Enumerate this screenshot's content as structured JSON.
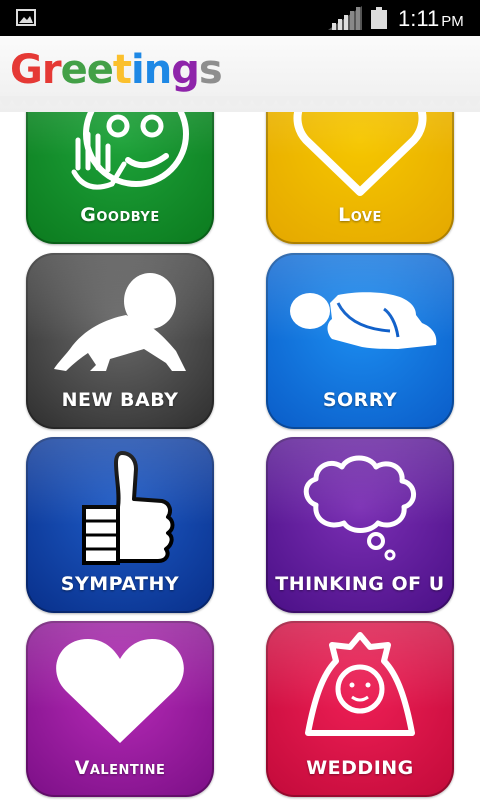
{
  "status_bar": {
    "time": "1:11",
    "ampm": "PM",
    "icons": [
      "image-icon",
      "signal-icon",
      "battery-icon"
    ]
  },
  "header": {
    "title_letters": [
      {
        "ch": "G",
        "color": "#e53935"
      },
      {
        "ch": "r",
        "color": "#e53935"
      },
      {
        "ch": "e",
        "color": "#43a047"
      },
      {
        "ch": "e",
        "color": "#43a047"
      },
      {
        "ch": "t",
        "color": "#fbc02d"
      },
      {
        "ch": "i",
        "color": "#1e88e5"
      },
      {
        "ch": "n",
        "color": "#1e88e5"
      },
      {
        "ch": "g",
        "color": "#8e24aa"
      },
      {
        "ch": "s",
        "color": "#8e8e8e"
      }
    ]
  },
  "tiles": [
    {
      "label": "Goodbye",
      "icon": "waving-face-icon",
      "color": "#0b7a1e"
    },
    {
      "label": "Love",
      "icon": "heart-outline-icon",
      "color": "#e4a700"
    },
    {
      "label": "NEW BABY",
      "icon": "crawling-baby-icon",
      "color": "#2e2e2e"
    },
    {
      "label": "SORRY",
      "icon": "bowing-person-icon",
      "color": "#0a5cc8"
    },
    {
      "label": "SYMPATHY",
      "icon": "thumbs-up-icon",
      "color": "#082f8a"
    },
    {
      "label": "THINKING OF U",
      "icon": "thought-bubble-icon",
      "color": "#4a0f86"
    },
    {
      "label": "Valentine",
      "icon": "heart-icon",
      "color": "#7b0f86"
    },
    {
      "label": "WEDDING",
      "icon": "bride-icon",
      "color": "#c20a3a"
    }
  ]
}
